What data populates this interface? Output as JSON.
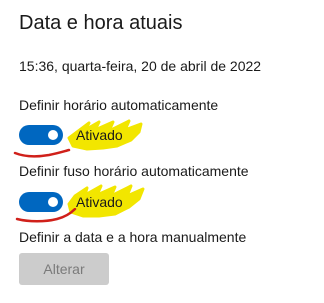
{
  "page": {
    "title": "Data e hora atuais",
    "current_datetime": "15:36, quarta-feira, 20 de abril de 2022"
  },
  "settings": {
    "auto_time": {
      "label": "Definir horário automaticamente",
      "state_label": "Ativado",
      "on": true
    },
    "auto_timezone": {
      "label": "Definir fuso horário automaticamente",
      "state_label": "Ativado",
      "on": true
    },
    "manual": {
      "label": "Definir a data e a hora manualmente",
      "button_label": "Alterar",
      "button_enabled": false
    }
  },
  "colors": {
    "toggle_on": "#0067c0",
    "highlight": "#f2e600",
    "annotation": "#d0201a",
    "button_disabled_bg": "#cccccc",
    "button_disabled_text": "#7a7a7a"
  },
  "icons": {
    "highlight_mark": "yellow-highlighter-scribble",
    "underline_mark": "red-pen-underline"
  }
}
